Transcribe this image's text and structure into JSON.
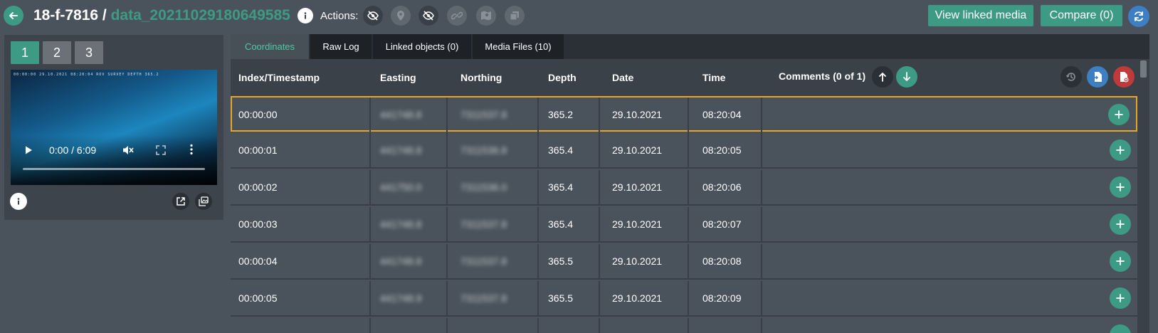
{
  "header": {
    "project_id": "18-f-7816",
    "separator": " / ",
    "file_name": "data_20211029180649585",
    "actions_label": "Actions:",
    "view_linked_media_label": "View linked media",
    "compare_label": "Compare (0)",
    "action_icons": [
      "eye-off-icon",
      "map-pin-icon",
      "eye-off-icon",
      "link-icon",
      "map-icon",
      "layers-icon"
    ]
  },
  "left_panel": {
    "pages": [
      "1",
      "2",
      "3"
    ],
    "active_page": "1",
    "video": {
      "osd_text": "00:00:00  29.10.2021  08:20:04  ROV  SURVEY  DEPTH 365.2",
      "time_display": "0:00 / 6:09",
      "progress_fraction": 0.0
    }
  },
  "tabs": [
    {
      "label": "Coordinates",
      "active": true
    },
    {
      "label": "Raw Log",
      "active": false
    },
    {
      "label": "Linked objects (0)",
      "active": false
    },
    {
      "label": "Media Files (10)",
      "active": false
    }
  ],
  "table": {
    "columns": {
      "index": "Index/Timestamp",
      "easting": "Easting",
      "northing": "Northing",
      "depth": "Depth",
      "date": "Date",
      "time": "Time",
      "comments": "Comments (0 of 1)"
    },
    "rows": [
      {
        "index": "00:00:00",
        "easting": "441748.8",
        "northing": "7311537.8",
        "depth": "365.2",
        "date": "29.10.2021",
        "time": "08:20:04"
      },
      {
        "index": "00:00:01",
        "easting": "441748.8",
        "northing": "7311536.8",
        "depth": "365.4",
        "date": "29.10.2021",
        "time": "08:20:05"
      },
      {
        "index": "00:00:02",
        "easting": "441750.0",
        "northing": "7311536.0",
        "depth": "365.4",
        "date": "29.10.2021",
        "time": "08:20:06"
      },
      {
        "index": "00:00:03",
        "easting": "441748.8",
        "northing": "7311537.8",
        "depth": "365.4",
        "date": "29.10.2021",
        "time": "08:20:07"
      },
      {
        "index": "00:00:04",
        "easting": "441748.8",
        "northing": "7311537.8",
        "depth": "365.5",
        "date": "29.10.2021",
        "time": "08:20:08"
      },
      {
        "index": "00:00:05",
        "easting": "441748.9",
        "northing": "7311537.8",
        "depth": "365.5",
        "date": "29.10.2021",
        "time": "08:20:09"
      }
    ]
  },
  "colors": {
    "accent": "#3d9a85",
    "selected_border": "#e8a526",
    "blue": "#3d7fc2",
    "red": "#c0393b"
  }
}
